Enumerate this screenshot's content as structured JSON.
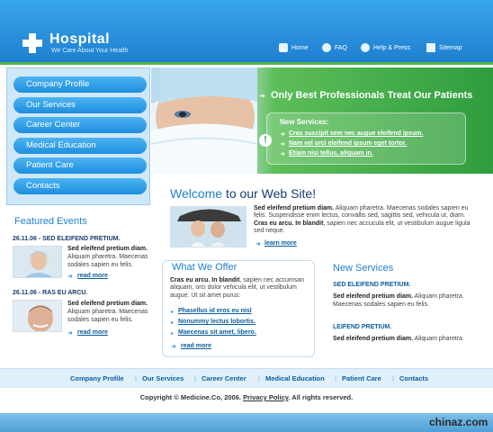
{
  "header": {
    "title": "Hospital",
    "tagline": "We Care About Your Health",
    "nav": [
      "Home",
      "FAQ",
      "Help & Press",
      "Sitemap"
    ]
  },
  "leftnav": [
    "Company Profile",
    "Our Services",
    "Career Center",
    "Medical Education",
    "Patient Care",
    "Contacts"
  ],
  "hero": {
    "headline": "Only Best Professionals Treat Our Patients",
    "news_title": "New Services:",
    "news_links": [
      "Cras suscipit sem nec augue eleifend ipsum.",
      "Nam vel orci eleifend ipsum eget tortor.",
      "Etiam nisi tellus, aliquam in."
    ]
  },
  "welcome": {
    "title_a": "Welcome",
    "title_b": " to our Web Site!",
    "p1_bold": "Sed eleifend pretium diam.",
    "p1": " Aliquam pharetra. Maecenas sodales sapien eu felis. Suspendisse enim lectus, convallis sed, sagittis sed, vehicula ut, diam.",
    "p2_bold": "Cras eu arcu. In blandit",
    "p2": ", sapien nec accucula elit, ut vestibulum augue ligula sed neque.",
    "more": "learn more"
  },
  "featured": {
    "title": "Featured Events",
    "events": [
      {
        "date": "26.11.06 - SED ELEIFEND PRETIUM.",
        "bold": "Sed eleifend pretium diam.",
        "text": " Aliquam pharetra. Maecenas sodales sapien eu felis.",
        "more": "read more"
      },
      {
        "date": "26.11.06 - RAS EU ARCU.",
        "bold": "Sed eleifend pretium diam.",
        "text": " Aliquam pharetra. Maecenas sodales sapien eu felis.",
        "more": "read more"
      }
    ]
  },
  "offer": {
    "title": "What We Offer",
    "bold": "Cras eu arcu. In blandit",
    "text": ", sapien nec accumsan aliquam, orci dolor vehicula elit, ut vestibulum augue. Ut sit amet purus:",
    "links": [
      "Phasellus id eros eu nisl",
      "Nonummy lectus lobortis.",
      "Maecenas sit amet, libero."
    ],
    "more": "read more"
  },
  "new_services": {
    "title": "New Services",
    "items": [
      {
        "head": "SED ELEIFEND PRETIUM.",
        "bold": "Sed eleifend pretium diam.",
        "text": " Aliquam pharetra. Maecenas sodales sapien eu felis."
      },
      {
        "head": "LEIFEND PRETIUM.",
        "bold": "Sed eleifend pretium diam.",
        "text": " Aliquam pharetra."
      }
    ]
  },
  "footer": {
    "nav": [
      "Company Profile",
      "Our Services",
      "Career Center",
      "Medical Education",
      "Patient Care",
      "Contacts"
    ],
    "copyright_a": "Copyright © Medicine.Co, 2006. ",
    "privacy": "Privacy Policy",
    "copyright_b": ". All rights reserved."
  },
  "watermark": "chinaz.com",
  "colors": {
    "accent": "#1f7fd0",
    "green": "#2f9d3d"
  }
}
